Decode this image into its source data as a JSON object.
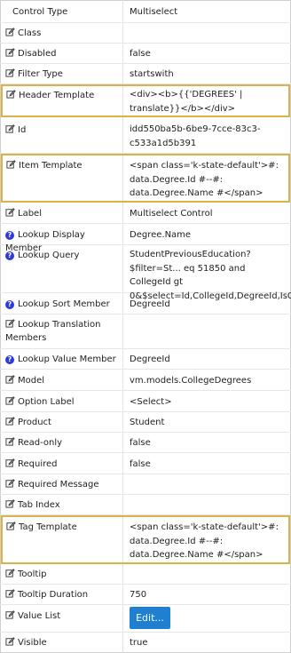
{
  "header": {
    "name": "Control Type",
    "value": "Multiselect"
  },
  "rows": [
    {
      "label": "Class",
      "value": ""
    },
    {
      "label": "Disabled",
      "value": "false"
    },
    {
      "label": "Filter Type",
      "value": "startswith"
    },
    {
      "label": "Header Template",
      "value": "<div><b>{{'DEGREES' | translate}}</b></div>"
    },
    {
      "label": "Id",
      "value": "idd550ba5b-6be9-7cce-83c3-c533a1d5b391"
    },
    {
      "label": "Item Template",
      "value": "<span class='k-state-default'>#: data.Degree.Id #--#: data.Degree.Name #</span>"
    },
    {
      "label": "Label",
      "value": "Multiselect Control"
    },
    {
      "label": "Lookup Display Member",
      "value": "Degree.Name"
    },
    {
      "label": "Lookup Query",
      "value": "StudentPreviousEducation?$filter=St... eq 51850 and CollegeId gt 0&$select=Id,CollegeId,DegreeId,IsG..."
    },
    {
      "label": "Lookup Sort Member",
      "value": "DegreeId"
    },
    {
      "label": "Lookup Translation Members",
      "value": ""
    },
    {
      "label": "Lookup Value Member",
      "value": "DegreeId"
    },
    {
      "label": "Model",
      "value": "vm.models.CollegeDegrees"
    },
    {
      "label": "Option Label",
      "value": "<Select>"
    },
    {
      "label": "Product",
      "value": "Student"
    },
    {
      "label": "Read-only",
      "value": "false"
    },
    {
      "label": "Required",
      "value": "false"
    },
    {
      "label": "Required Message",
      "value": ""
    },
    {
      "label": "Tab Index",
      "value": ""
    },
    {
      "label": "Tag Template",
      "value": "<span class='k-state-default'>#: data.Degree.Id #--#: data.Degree.Name #</span>"
    },
    {
      "label": "Tooltip",
      "value": ""
    },
    {
      "label": "Tooltip Duration",
      "value": "750"
    },
    {
      "label": "Value List",
      "value": "",
      "button": "Edit..."
    },
    {
      "label": "Visible",
      "value": "true"
    }
  ],
  "icons": {
    "edit": "edit-icon",
    "help": "help-icon"
  },
  "colors": {
    "highlight": "#d9b24a",
    "help": "#2f3bd6",
    "button": "#1f7fd1"
  }
}
